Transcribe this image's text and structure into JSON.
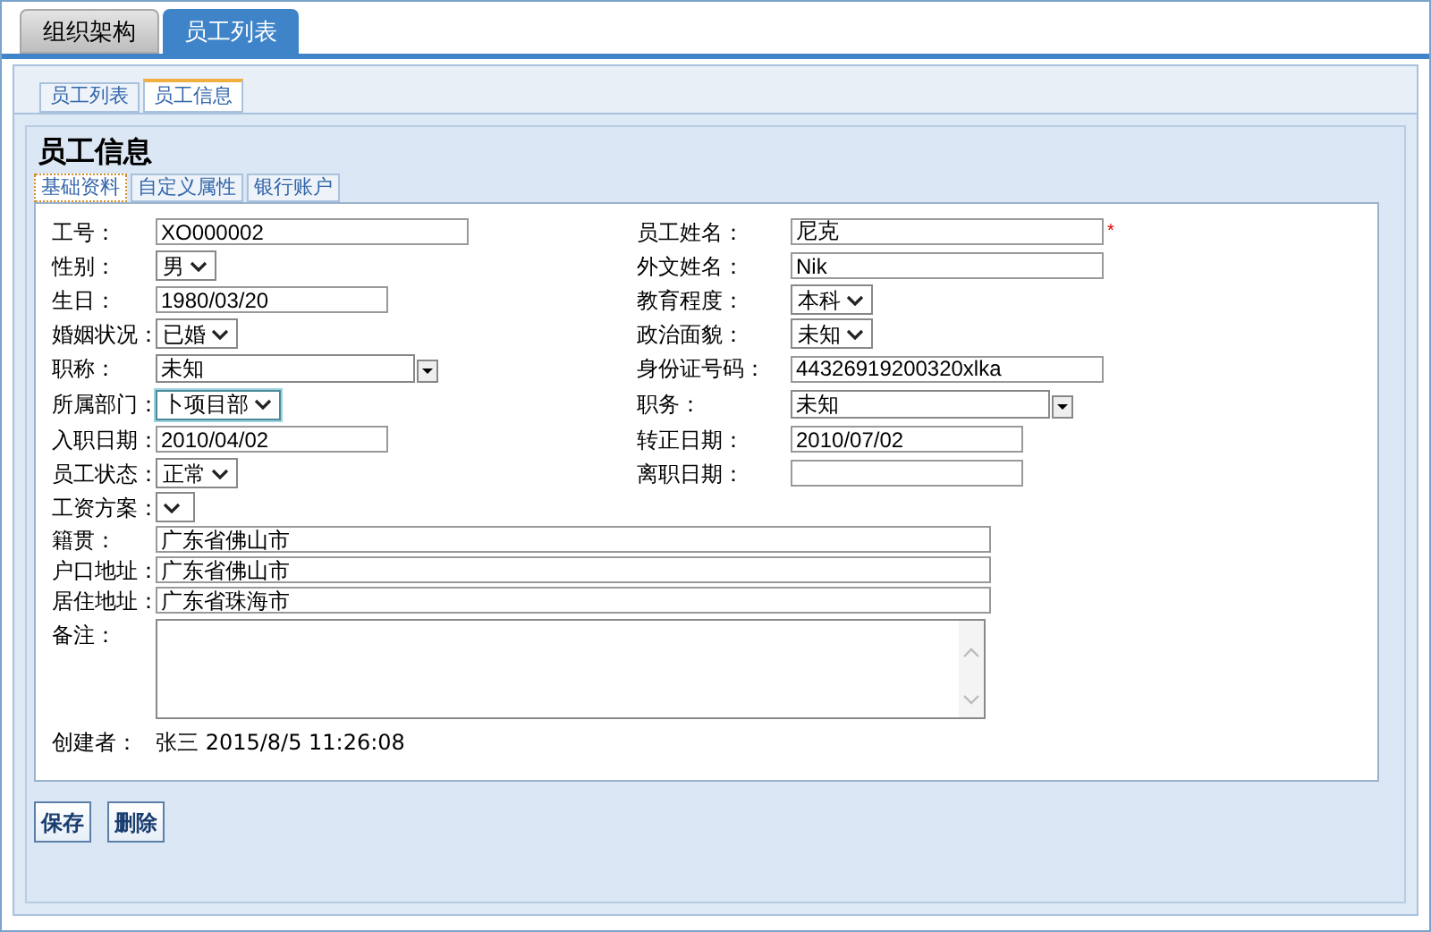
{
  "top_tabs": [
    {
      "label": "组织架构",
      "selected": false
    },
    {
      "label": "员工列表",
      "selected": true
    }
  ],
  "sub_tabs": [
    {
      "label": "员工列表",
      "selected": false
    },
    {
      "label": "员工信息",
      "selected": true
    }
  ],
  "title": "员工信息",
  "form_tabs": [
    {
      "label": "基础资料",
      "selected": true
    },
    {
      "label": "自定义属性",
      "selected": false
    },
    {
      "label": "银行账户",
      "selected": false
    }
  ],
  "rows": [
    {
      "left": {
        "label": "工号：",
        "kind": "text",
        "value": "XO000002"
      },
      "right": {
        "label": "员工姓名：",
        "kind": "text",
        "value": "尼克",
        "required_mark": "*"
      }
    },
    {
      "left": {
        "label": "性别：",
        "kind": "select",
        "value": "男"
      },
      "right": {
        "label": "外文姓名：",
        "kind": "text",
        "value": "Nik"
      }
    },
    {
      "left": {
        "label": "生日：",
        "kind": "date",
        "value": "1980/03/20"
      },
      "right": {
        "label": "教育程度：",
        "kind": "select",
        "value": "本科"
      }
    },
    {
      "left": {
        "label": "婚姻状况：",
        "kind": "select",
        "value": "已婚"
      },
      "right": {
        "label": "政治面貌：",
        "kind": "select",
        "value": "未知"
      }
    },
    {
      "left": {
        "label": "职称：",
        "kind": "combo",
        "value": "未知"
      },
      "right": {
        "label": "身份证号码：",
        "kind": "text",
        "value": "44326919200320xlka"
      }
    },
    {
      "left": {
        "label": "所属部门：",
        "kind": "select",
        "value": "卜项目部",
        "focused": true
      },
      "right": {
        "label": "职务：",
        "kind": "combo",
        "value": "未知"
      }
    },
    {
      "left": {
        "label": "入职日期：",
        "kind": "date",
        "value": "2010/04/02"
      },
      "right": {
        "label": "转正日期：",
        "kind": "date",
        "value": "2010/07/02"
      }
    },
    {
      "left": {
        "label": "员工状态：",
        "kind": "select",
        "value": "正常"
      },
      "right": {
        "label": "离职日期：",
        "kind": "date"
      }
    },
    {
      "left": {
        "label": "工资方案：",
        "kind": "select"
      }
    }
  ],
  "address_rows": [
    {
      "label": "籍贯：",
      "value": "广东省佛山市"
    },
    {
      "label": "户口地址：",
      "value": "广东省佛山市"
    },
    {
      "label": "居住地址：",
      "value": "广东省珠海市"
    }
  ],
  "remarks": {
    "label": "备注："
  },
  "creator": {
    "label": "创建者：",
    "value": "张三 2015/8/5 11:26:08"
  },
  "buttons": [
    "保存",
    "删除"
  ]
}
